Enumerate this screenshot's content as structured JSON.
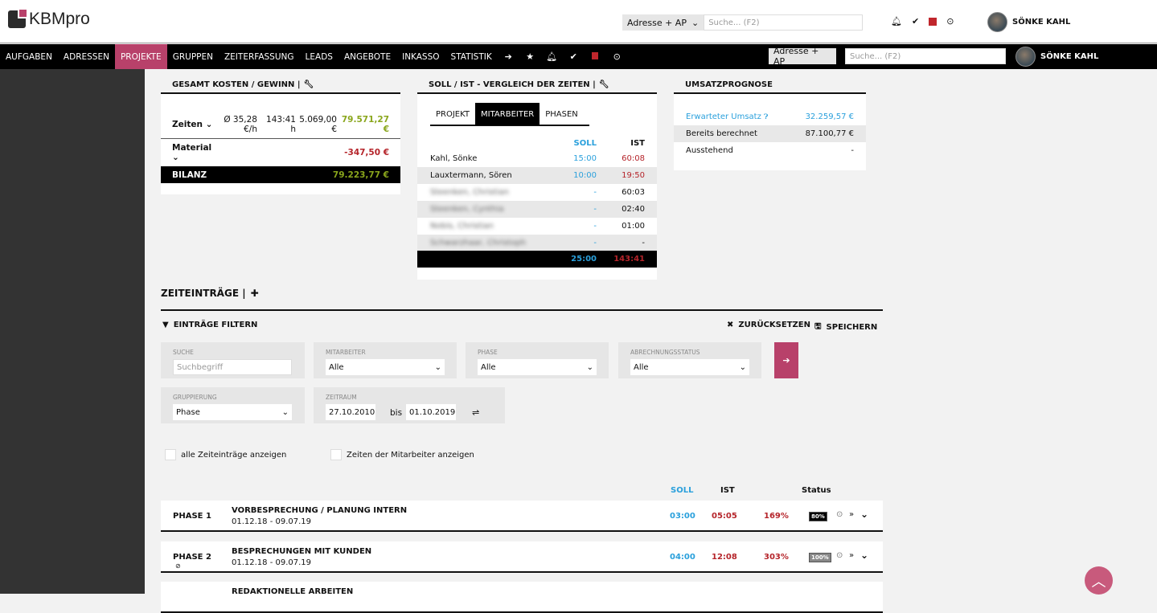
{
  "app": {
    "logo": "KBMpro"
  },
  "header": {
    "search_scope": "Adresse + AP",
    "search_placeholder": "Suche... (F2)",
    "user": "SÖNKE KAHL"
  },
  "nav": {
    "items": [
      "AUFGABEN",
      "ADRESSEN",
      "PROJEKTE",
      "GRUPPEN",
      "ZEITERFASSUNG",
      "LEADS",
      "ANGEBOTE",
      "INKASSO",
      "STATISTIK"
    ],
    "active": "PROJEKTE",
    "search_scope": "Adresse + AP",
    "search_placeholder": "Suche... (F2)",
    "user": "SÖNKE KAHL"
  },
  "costs": {
    "title": "GESAMT KOSTEN / GEWINN |",
    "zeiten_label": "Zeiten",
    "avg_rate": "Ø 35,28",
    "avg_unit": "€/h",
    "hours": "143:41",
    "hours_unit": "h",
    "cost": "5.069,00",
    "cost_unit": "€",
    "zeiten_total": "79.571,27 €",
    "material_label": "Material",
    "material_total": "-347,50 €",
    "bilanz_label": "BILANZ",
    "bilanz_total": "79.223,77 €"
  },
  "sollist": {
    "title": "SOLL / IST - VERGLEICH DER ZEITEN |",
    "tabs": [
      "PROJEKT",
      "MITARBEITER",
      "PHASEN"
    ],
    "active_tab": "MITARBEITER",
    "col_soll": "SOLL",
    "col_ist": "IST",
    "rows": [
      {
        "name": "Kahl, Sönke",
        "soll": "15:00",
        "ist": "60:08",
        "over": true,
        "blurred": false
      },
      {
        "name": "Lauxtermann, Sören",
        "soll": "10:00",
        "ist": "19:50",
        "over": true,
        "blurred": false
      },
      {
        "name": "Steenken, Christian",
        "soll": "-",
        "ist": "60:03",
        "over": false,
        "blurred": true
      },
      {
        "name": "Steenken, Cynthia",
        "soll": "-",
        "ist": "02:40",
        "over": false,
        "blurred": true
      },
      {
        "name": "Nobis, Christian",
        "soll": "-",
        "ist": "01:00",
        "over": false,
        "blurred": true
      },
      {
        "name": "Schwarzhaar, Christoph",
        "soll": "-",
        "ist": "-",
        "over": false,
        "blurred": true
      }
    ],
    "total_soll": "25:00",
    "total_ist": "143:41"
  },
  "forecast": {
    "title": "UMSATZPROGNOSE",
    "rows": [
      {
        "label": "Erwarteter Umsatz",
        "value": "32.259,57 €"
      },
      {
        "label": "Bereits berechnet",
        "value": "87.100,77 €"
      },
      {
        "label": "Ausstehend",
        "value": "-"
      }
    ]
  },
  "entries": {
    "title": "ZEITEINTRÄGE |",
    "filter_title": "EINTRÄGE FILTERN",
    "reset": "ZURÜCKSETZEN",
    "save": "SPEICHERN",
    "search_label": "SUCHE",
    "search_placeholder": "Suchbegriff",
    "employee_label": "MITARBEITER",
    "employee_value": "Alle",
    "phase_label": "PHASE",
    "phase_value": "Alle",
    "billing_label": "ABRECHNUNGSSTATUS",
    "billing_value": "Alle",
    "group_label": "GRUPPIERUNG",
    "group_value": "Phase",
    "period_label": "ZEITRAUM",
    "from": "27.10.2010",
    "bis": "bis",
    "to": "01.10.2019",
    "chk_all": "alle Zeiteinträge anzeigen",
    "chk_employee": "Zeiten der Mitarbeiter anzeigen",
    "col_soll": "SOLL",
    "col_ist": "IST",
    "col_status": "Status",
    "phases": [
      {
        "phase": "PHASE 1",
        "title": "VORBESPRECHUNG / PLANUNG INTERN",
        "dates": "01.12.18 - 09.07.19",
        "soll": "03:00",
        "ist": "05:05",
        "pct": "169%",
        "status": "80%",
        "status_color": "#000000"
      },
      {
        "phase": "PHASE 2",
        "title": "BESPRECHUNGEN MIT KUNDEN",
        "dates": "01.12.18 - 09.07.19",
        "soll": "04:00",
        "ist": "12:08",
        "pct": "303%",
        "status": "100%",
        "status_color": "#888888"
      },
      {
        "phase": "",
        "title": "REDAKTIONELLE ARBEITEN",
        "dates": "",
        "soll": "",
        "ist": "",
        "pct": "",
        "status": "",
        "status_color": "#cccccc"
      }
    ]
  },
  "colors": {
    "accent": "#b8416a",
    "blue": "#2aa0dc",
    "red": "#b5242a",
    "green": "#8aa61c"
  }
}
